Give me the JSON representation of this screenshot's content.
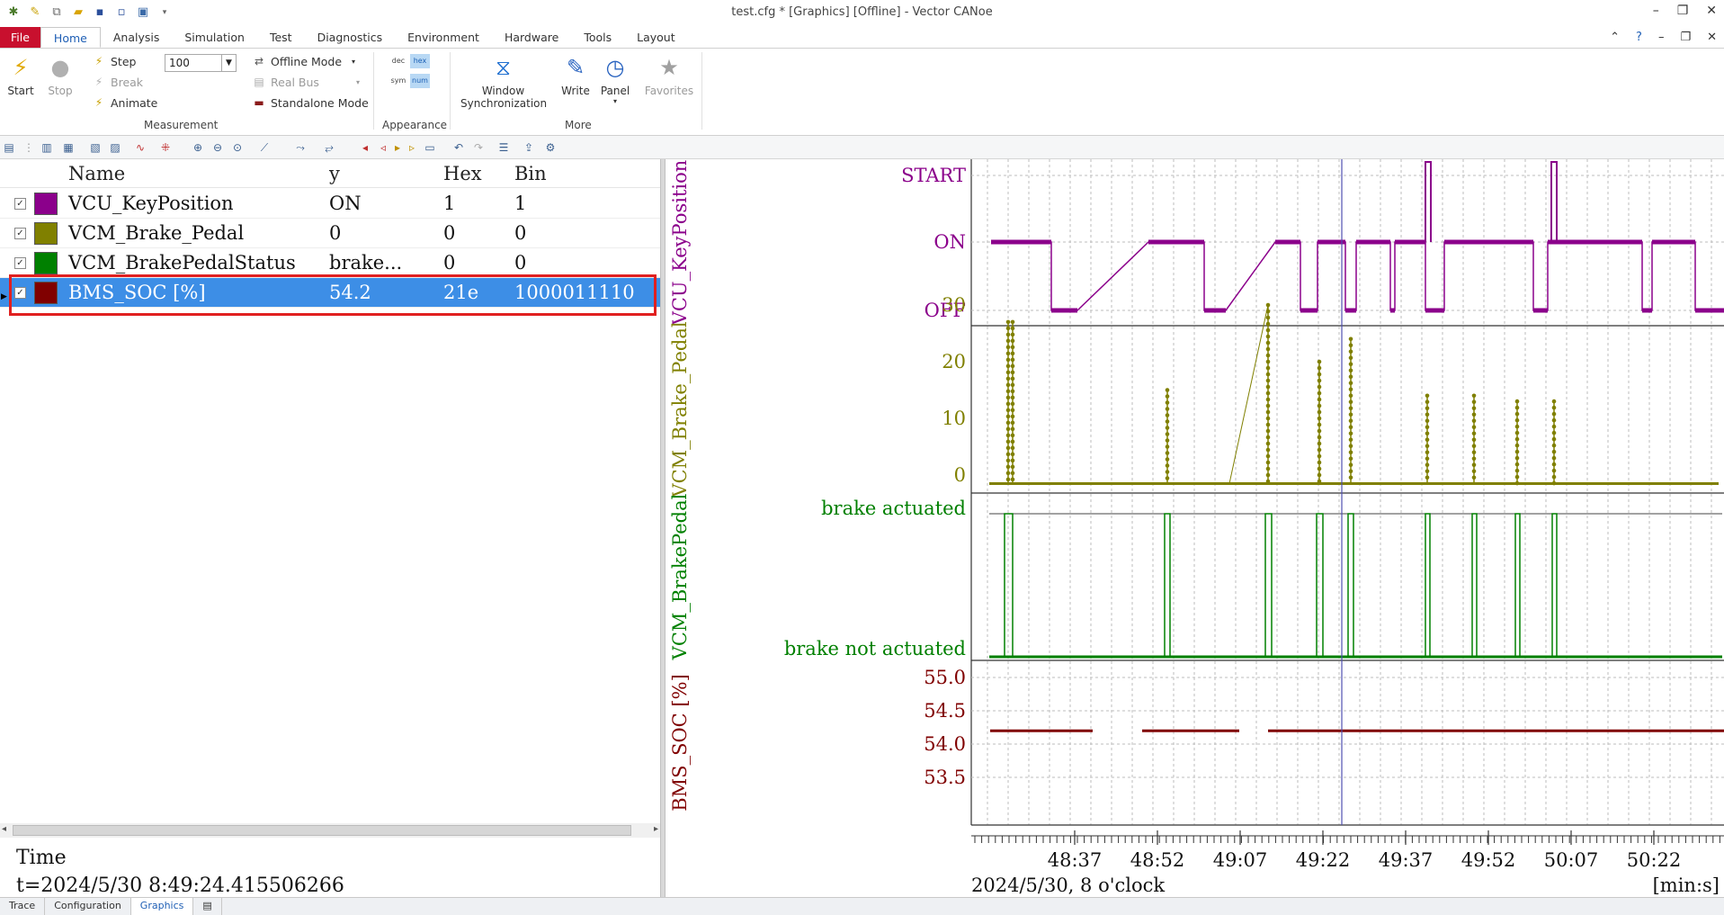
{
  "window": {
    "title": "test.cfg * [Graphics] [Offline] - Vector CANoe"
  },
  "tabs": {
    "file": "File",
    "items": [
      "Home",
      "Analysis",
      "Simulation",
      "Test",
      "Diagnostics",
      "Environment",
      "Hardware",
      "Tools",
      "Layout"
    ],
    "active": "Home"
  },
  "ribbon": {
    "start": "Start",
    "stop": "Stop",
    "step": "Step",
    "break": "Break",
    "animate": "Animate",
    "speed_value": "100",
    "offline_mode": "Offline Mode",
    "real_bus": "Real Bus",
    "standalone_mode": "Standalone Mode",
    "group_measurement": "Measurement",
    "fmt_dec": "dec",
    "fmt_hex": "hex",
    "fmt_sym": "sym",
    "fmt_num": "num",
    "group_appearance": "Appearance",
    "window_sync": "Window Synchronization",
    "write": "Write",
    "panel": "Panel",
    "favorites": "Favorites",
    "group_more": "More"
  },
  "signal_table": {
    "headers": {
      "name": "Name",
      "y": "y",
      "hex": "Hex",
      "bin": "Bin"
    },
    "rows": [
      {
        "name": "VCU_KeyPosition",
        "y": "ON",
        "hex": "1",
        "bin": "1",
        "color": "#8b008b",
        "selected": false
      },
      {
        "name": "VCM_Brake_Pedal",
        "y": "0",
        "hex": "0",
        "bin": "0",
        "color": "#808000",
        "selected": false
      },
      {
        "name": "VCM_BrakePedalStatus",
        "y": "brake...",
        "hex": "0",
        "bin": "0",
        "color": "#008000",
        "selected": false
      },
      {
        "name": "BMS_SOC [%]",
        "y": "54.2",
        "hex": "21e",
        "bin": "1000011110",
        "color": "#800000",
        "selected": true
      }
    ]
  },
  "time_info": {
    "label": "Time",
    "value": "t=2024/5/30 8:49:24.415506266"
  },
  "chart_data": {
    "type": "line",
    "x_unit": "[min:s]",
    "x_date_label": "2024/5/30, 8 o'clock",
    "x_ticks": [
      "48:37",
      "48:52",
      "49:07",
      "49:22",
      "49:37",
      "49:52",
      "50:07",
      "50:22"
    ],
    "cursor_time": "8:49:24.415506266",
    "series": [
      {
        "name": "VCU_KeyPosition",
        "color": "#8b008b",
        "y_tick_labels": [
          "START",
          "ON",
          "OFF"
        ],
        "ylim": [
          0,
          2
        ]
      },
      {
        "name": "VCM_Brake_Pedal",
        "color": "#808000",
        "y_tick_labels": [
          "30",
          "20",
          "10",
          "0"
        ],
        "ylim": [
          -5,
          32
        ]
      },
      {
        "name": "VCM_BrakePedalStatus",
        "color": "#008000",
        "y_tick_labels": [
          "brake actuated",
          "brake not actuated"
        ],
        "ylim": [
          0,
          1
        ]
      },
      {
        "name": "BMS_SOC [%]",
        "color": "#800000",
        "y_tick_labels": [
          "55.0",
          "54.5",
          "54.0",
          "53.5"
        ],
        "ylim": [
          53.3,
          55.1
        ],
        "value": 54.2
      }
    ]
  },
  "bottom_tabs": [
    "Trace",
    "Configuration",
    "Graphics"
  ]
}
